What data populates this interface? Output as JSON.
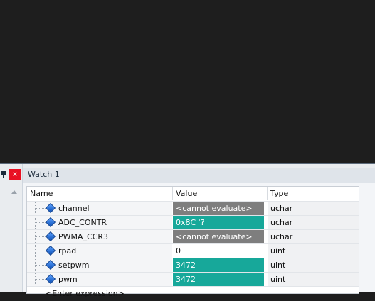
{
  "left_pane": {
    "pin_icon": "pin-icon",
    "close_icon": "close-icon",
    "close_glyph": "x"
  },
  "watch": {
    "title": "Watch 1",
    "columns": {
      "name": "Name",
      "value": "Value",
      "type": "Type"
    },
    "rows": [
      {
        "name": "channel",
        "value": "<cannot evaluate>",
        "type": "uchar",
        "state": "cannot"
      },
      {
        "name": "ADC_CONTR",
        "value": "0x8C '?",
        "type": "uchar",
        "state": "changed"
      },
      {
        "name": "PWMA_CCR3",
        "value": "<cannot evaluate>",
        "type": "uchar",
        "state": "cannot"
      },
      {
        "name": "rpad",
        "value": "0",
        "type": "uint",
        "state": "plain"
      },
      {
        "name": "setpwm",
        "value": "3472",
        "type": "uint",
        "state": "changed"
      },
      {
        "name": "pwm",
        "value": "3472",
        "type": "uint",
        "state": "changed"
      }
    ],
    "enter_expression": "<Enter expression>"
  },
  "colors": {
    "changed": "#17a89a",
    "cannot_evaluate": "#7e7e7e",
    "close_button": "#e81123"
  }
}
